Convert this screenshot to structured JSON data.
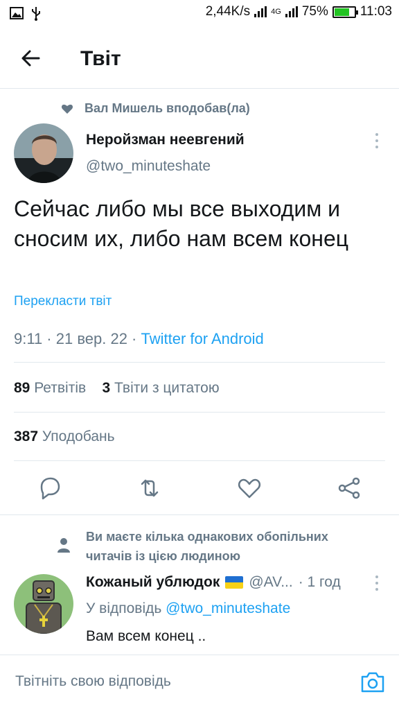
{
  "status_bar": {
    "speed": "2,44K/s",
    "network": "4G",
    "battery": "75%",
    "battery_level": 0.75,
    "time": "11:03",
    "icons": [
      "image-icon",
      "usb-icon",
      "signal-icon",
      "battery-icon"
    ]
  },
  "header": {
    "title": "Твіт"
  },
  "social_context": {
    "text": "Вал Мишель вподобав(ла)",
    "icon": "heart-icon"
  },
  "tweet": {
    "author_name": "Неройзман неевгений",
    "author_handle": "@two_minuteshate",
    "text": "Сейчас либо мы все выходим и сносим их, либо нам всем конец",
    "translate_label": "Перекласти твіт",
    "time_date": "9:11 · 21 вер. 22 · ",
    "client": "Twitter for Android"
  },
  "stats": {
    "retweets_count": "89",
    "retweets_label": "Ретвітів",
    "quotes_count": "3",
    "quotes_label": "Твіти з цитатою",
    "likes_count": "387",
    "likes_label": "Уподобань"
  },
  "actions": {
    "icons": [
      "reply-icon",
      "retweet-icon",
      "like-icon",
      "share-icon"
    ],
    "accent": "#1da1f2",
    "icon_color": "#657786"
  },
  "mutual": {
    "text": "Ви маєте кілька однакових обопільних читачів із цією людиною",
    "icon": "person-icon"
  },
  "reply": {
    "author_name": "Кожаный ублюдок",
    "author_handle": "@AV...",
    "time": "· 1 год",
    "replying_prefix": "У відповідь",
    "replying_to": "@two_minuteshate",
    "text": "Вам всем конец .."
  },
  "composer": {
    "placeholder": "Твітніть свою відповідь"
  }
}
